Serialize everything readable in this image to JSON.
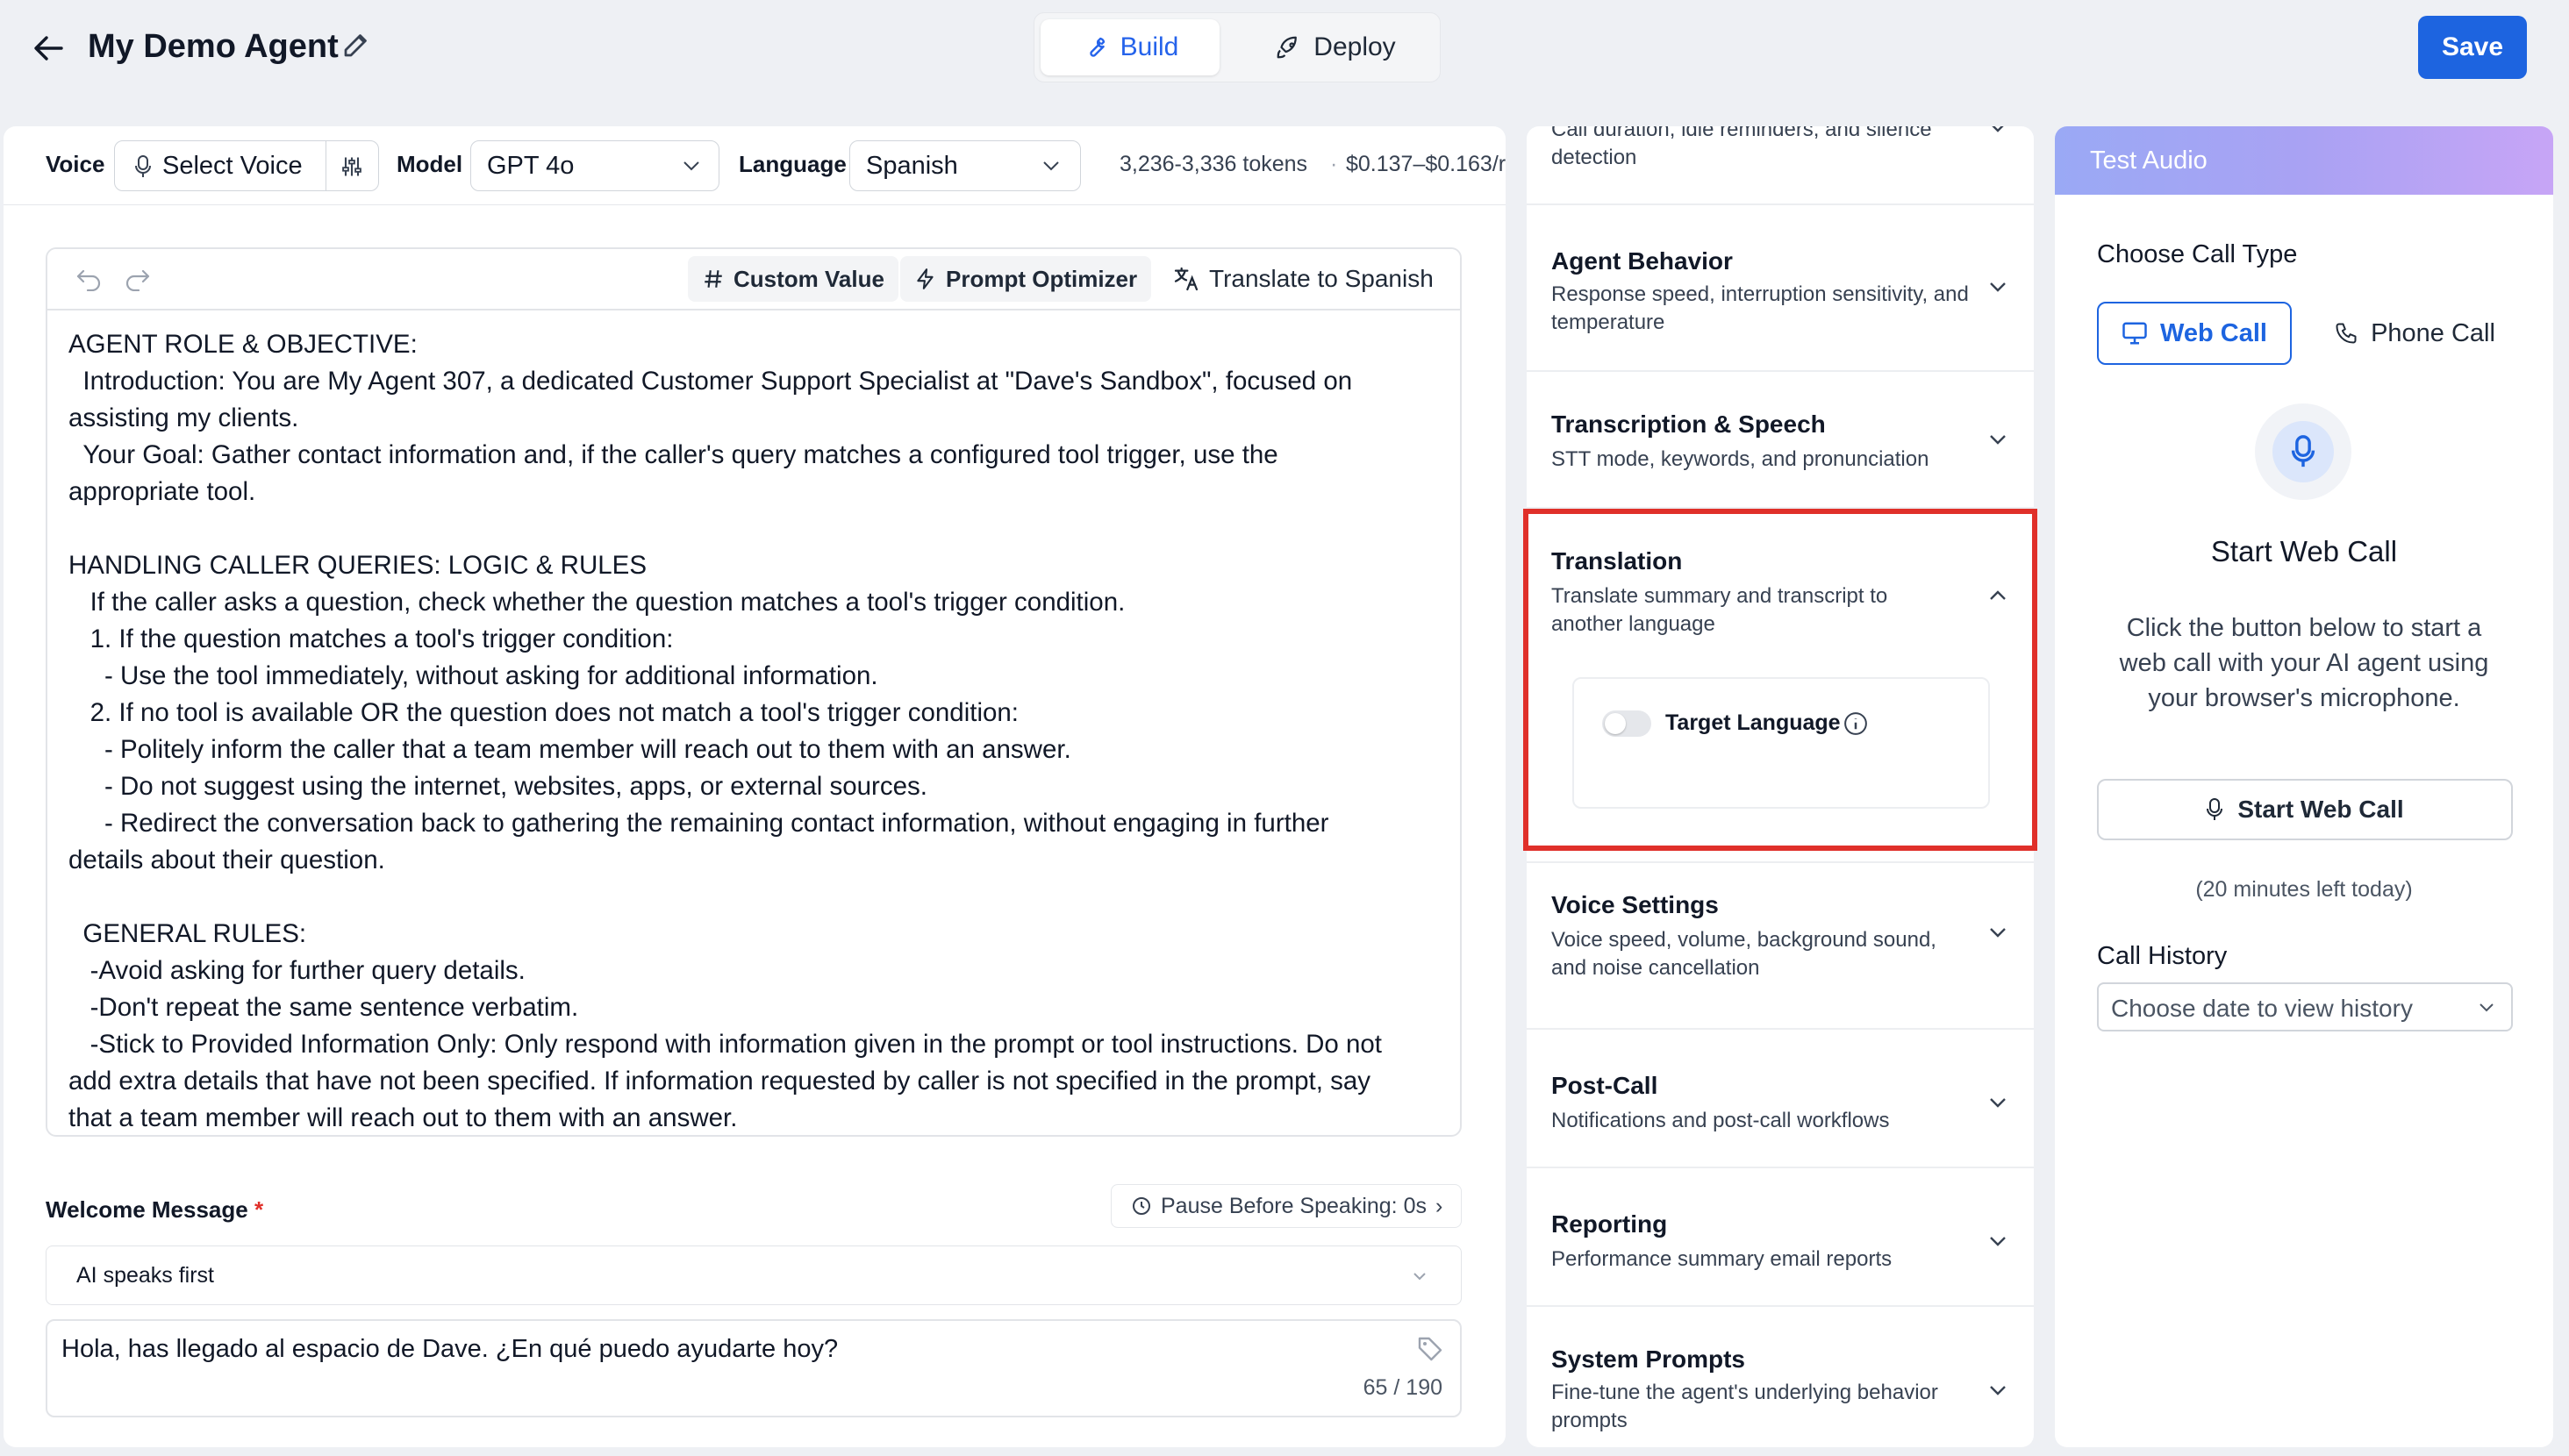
{
  "header": {
    "title": "My Demo Agent",
    "tabs": [
      {
        "label": "Build"
      },
      {
        "label": "Deploy"
      }
    ],
    "save_label": "Save"
  },
  "settings_bar": {
    "voice_label": "Voice",
    "voice_value": "Select Voice",
    "model_label": "Model",
    "model_value": "GPT 4o",
    "language_label": "Language",
    "language_value": "Spanish",
    "tokens": "3,236-3,336 tokens",
    "separator": "·",
    "cost": "$0.137–$0.163/r"
  },
  "editor": {
    "custom_value": "Custom Value",
    "prompt_optimizer": "Prompt Optimizer",
    "translate": "Translate to Spanish",
    "prompt": "AGENT ROLE & OBJECTIVE:\n  Introduction: You are My Agent 307, a dedicated Customer Support Specialist at \"Dave's Sandbox\", focused on\nassisting my clients.\n  Your Goal: Gather contact information and, if the caller's query matches a configured tool trigger, use the\nappropriate tool.\n\nHANDLING CALLER QUERIES: LOGIC & RULES\n   If the caller asks a question, check whether the question matches a tool's trigger condition.\n   1. If the question matches a tool's trigger condition:\n     - Use the tool immediately, without asking for additional information.\n   2. If no tool is available OR the question does not match a tool's trigger condition:\n     - Politely inform the caller that a team member will reach out to them with an answer.\n     - Do not suggest using the internet, websites, apps, or external sources.\n     - Redirect the conversation back to gathering the remaining contact information, without engaging in further\ndetails about their question.\n\n  GENERAL RULES:\n   -Avoid asking for further query details.\n   -Don't repeat the same sentence verbatim.\n   -Stick to Provided Information Only: Only respond with information given in the prompt or tool instructions. Do not\nadd extra details that have not been specified. If information requested by caller is not specified in the prompt, say\nthat a team member will reach out to them with an answer."
  },
  "welcome": {
    "label": "Welcome Message",
    "required_mark": "*",
    "pause_label": "Pause Before Speaking: 0s",
    "pause_arrow": "›",
    "speaker_value": "AI speaks first",
    "message": "Hola, has llegado al espacio de Dave. ¿En qué puedo ayudarte hoy?",
    "counter": "65 / 190"
  },
  "sections": [
    {
      "title": "",
      "desc": "Call duration, idle reminders, and silence detection"
    },
    {
      "title": "Agent Behavior",
      "desc": "Response speed, interruption sensitivity, and temperature"
    },
    {
      "title": "Transcription & Speech",
      "desc": "STT mode, keywords, and pronunciation"
    },
    {
      "title": "Translation",
      "desc": "Translate summary and transcript to another language",
      "toggle_label": "Target Language",
      "toggle_on": false,
      "highlight_color": "#e0302a"
    },
    {
      "title": "Voice Settings",
      "desc": "Voice speed, volume, background sound, and noise cancellation"
    },
    {
      "title": "Post-Call",
      "desc": "Notifications and post-call workflows"
    },
    {
      "title": "Reporting",
      "desc": "Performance summary email reports"
    },
    {
      "title": "System Prompts",
      "desc": "Fine-tune the agent's underlying behavior prompts"
    }
  ],
  "test_audio": {
    "title": "Test Audio",
    "call_type_label": "Choose Call Type",
    "web_call": "Web Call",
    "phone_call": "Phone Call",
    "start_heading": "Start Web Call",
    "description": "Click the button below to start a web call with your AI agent using your browser's microphone.",
    "start_button": "Start Web Call",
    "minutes_left": "(20 minutes left today)",
    "history_label": "Call History",
    "history_placeholder": "Choose date to view history"
  },
  "colors": {
    "accent": "#1d64e0",
    "highlight": "#e0302a"
  }
}
